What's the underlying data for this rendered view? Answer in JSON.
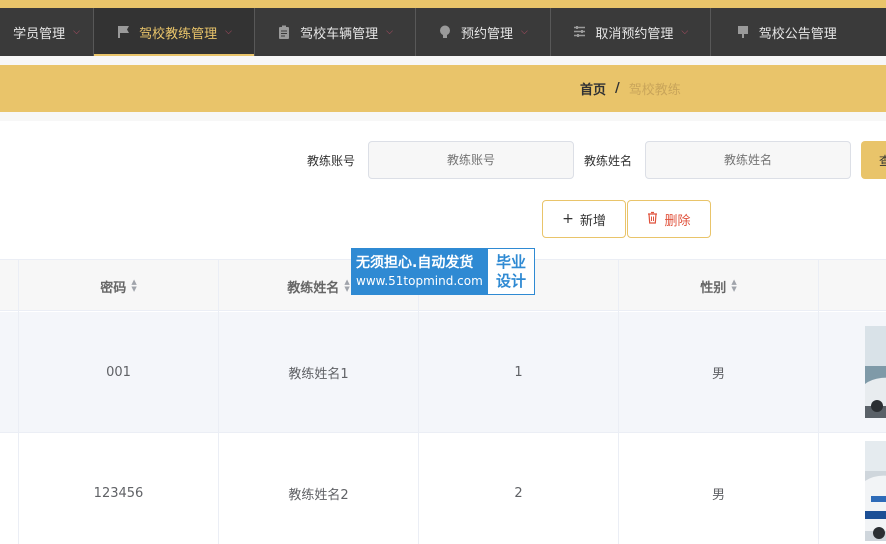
{
  "nav": {
    "items": [
      {
        "label": "学员管理",
        "icon": "none"
      },
      {
        "label": "驾校教练管理",
        "icon": "flag-icon"
      },
      {
        "label": "驾校车辆管理",
        "icon": "clipboard-icon"
      },
      {
        "label": "预约管理",
        "icon": "bulb-icon"
      },
      {
        "label": "取消预约管理",
        "icon": "sliders-icon"
      },
      {
        "label": "驾校公告管理",
        "icon": "sign-icon"
      }
    ],
    "active_index": 1,
    "accent_color": "#e9c46a",
    "background_color": "#3a3a3a"
  },
  "breadcrumb": {
    "home": "首页",
    "separator": "/",
    "current": "驾校教练"
  },
  "search": {
    "account_label": "教练账号",
    "account_placeholder": "教练账号",
    "account_value": "",
    "name_label": "教练姓名",
    "name_placeholder": "教练姓名",
    "name_value": "",
    "query_label": "查"
  },
  "actions": {
    "add_label": "新增",
    "delete_label": "删除"
  },
  "table": {
    "columns": [
      "密码",
      "教练姓名",
      "",
      "性别",
      ""
    ],
    "rows": [
      {
        "password": "001",
        "name": "教练姓名1",
        "col3": "1",
        "gender": "男"
      },
      {
        "password": "123456",
        "name": "教练姓名2",
        "col3": "2",
        "gender": "男"
      }
    ]
  },
  "watermark": {
    "line1": "无须担心.自动发货",
    "line2": "www.51topmind.com",
    "right1": "毕业",
    "right2": "设计"
  }
}
